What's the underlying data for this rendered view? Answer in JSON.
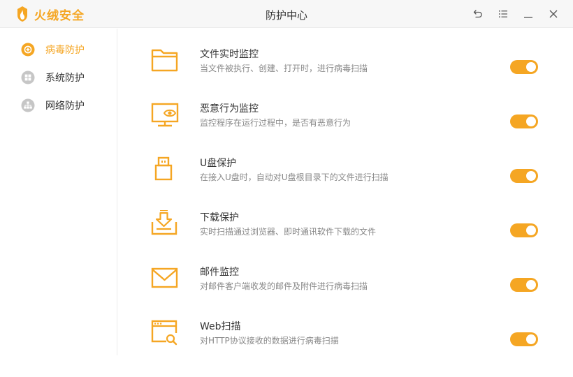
{
  "app": {
    "brand": "火绒安全",
    "window_title": "防护中心"
  },
  "colors": {
    "accent": "#f5a623",
    "inactive_icon": "#c6c6c6",
    "title_text": "#333333",
    "desc_text": "#888888"
  },
  "window_controls": [
    {
      "icon": "back-icon"
    },
    {
      "icon": "menu-icon"
    },
    {
      "icon": "minimize-icon"
    },
    {
      "icon": "close-icon"
    }
  ],
  "sidebar": {
    "items": [
      {
        "label": "病毒防护",
        "icon": "virus-protection-icon",
        "active": true
      },
      {
        "label": "系统防护",
        "icon": "system-protection-icon",
        "active": false
      },
      {
        "label": "网络防护",
        "icon": "network-protection-icon",
        "active": false
      }
    ]
  },
  "features": [
    {
      "title": "文件实时监控",
      "desc": "当文件被执行、创建、打开时，进行病毒扫描",
      "icon": "folder-icon",
      "enabled": true
    },
    {
      "title": "恶意行为监控",
      "desc": "监控程序在运行过程中，是否有恶意行为",
      "icon": "monitor-eye-icon",
      "enabled": true
    },
    {
      "title": "U盘保护",
      "desc": "在接入U盘时，自动对U盘根目录下的文件进行扫描",
      "icon": "usb-drive-icon",
      "enabled": true
    },
    {
      "title": "下载保护",
      "desc": "实时扫描通过浏览器、即时通讯软件下载的文件",
      "icon": "download-tray-icon",
      "enabled": true
    },
    {
      "title": "邮件监控",
      "desc": "对邮件客户端收发的邮件及附件进行病毒扫描",
      "icon": "mail-icon",
      "enabled": true
    },
    {
      "title": "Web扫描",
      "desc": "对HTTP协议接收的数据进行病毒扫描",
      "icon": "web-scan-icon",
      "enabled": true
    }
  ]
}
